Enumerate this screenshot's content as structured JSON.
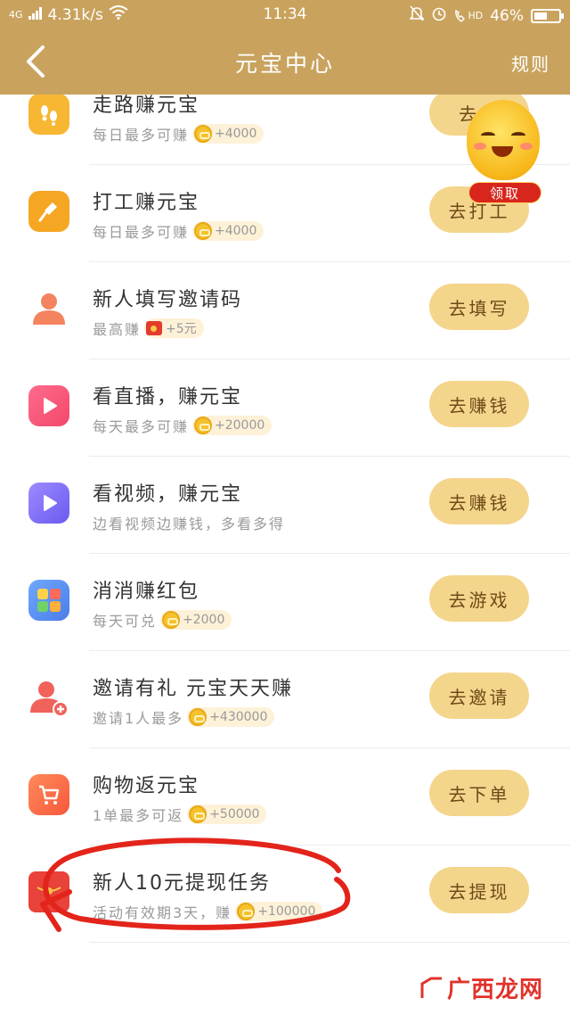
{
  "status_bar": {
    "network": "4G",
    "speed": "4.31k/s",
    "time": "11:34",
    "hd": "HD",
    "battery": "46%"
  },
  "header": {
    "back_icon": "chevron-left-icon",
    "title": "元宝中心",
    "rules_label": "规则"
  },
  "floating_mascot": {
    "badge_label": "领取"
  },
  "tasks": [
    {
      "name": "走路赚元宝",
      "sub": "每日最多可赚",
      "reward": "+4000",
      "reward_icon": "coin-icon",
      "button": "去走",
      "icon": "footprint-icon",
      "icon_color": "#f7b733"
    },
    {
      "name": "打工赚元宝",
      "sub": "每日最多可赚",
      "reward": "+4000",
      "reward_icon": "coin-icon",
      "button": "去打工",
      "icon": "shovel-icon",
      "icon_color": "#f5a623"
    },
    {
      "name": "新人填写邀请码",
      "sub": "最高赚",
      "reward": "+5元",
      "reward_icon": "red-envelope-icon",
      "button": "去填写",
      "icon": "person-icon",
      "icon_color": "#f4845f"
    },
    {
      "name": "看直播，赚元宝",
      "sub": "每天最多可赚",
      "reward": "+20000",
      "reward_icon": "coin-icon",
      "button": "去赚钱",
      "icon": "play-icon",
      "icon_color": "#f2486c"
    },
    {
      "name": "看视频，赚元宝",
      "sub": "边看视频边赚钱，多看多得",
      "reward": "",
      "reward_icon": "",
      "button": "去赚钱",
      "icon": "play-icon",
      "icon_color": "#7b6cf6"
    },
    {
      "name": "消消赚红包",
      "sub": "每天可兑",
      "reward": "+2000",
      "reward_icon": "coin-icon",
      "button": "去游戏",
      "icon": "puzzle-blocks-icon",
      "icon_color": "#5b8def"
    },
    {
      "name": "邀请有礼 元宝天天赚",
      "sub": "邀请1人最多",
      "reward": "+430000",
      "reward_icon": "coin-icon",
      "button": "去邀请",
      "icon": "add-person-icon",
      "icon_color": "#f0625a"
    },
    {
      "name": "购物返元宝",
      "sub": "1单最多可返",
      "reward": "+50000",
      "reward_icon": "coin-icon",
      "button": "去下单",
      "icon": "shopping-cart-icon",
      "icon_color": "#f76b4b"
    },
    {
      "name": "新人10元提现任务",
      "sub": "活动有效期3天，赚",
      "reward": "+100000",
      "reward_icon": "coin-icon",
      "button": "去提现",
      "icon": "red-envelope-icon",
      "icon_color": "#e8423a"
    }
  ],
  "watermark": {
    "text": "广西龙网"
  },
  "colors": {
    "header_bg": "#c9a35e",
    "button_bg": "#f4d58c",
    "button_text": "#6d4a17",
    "annotation_red": "#e3241b"
  }
}
